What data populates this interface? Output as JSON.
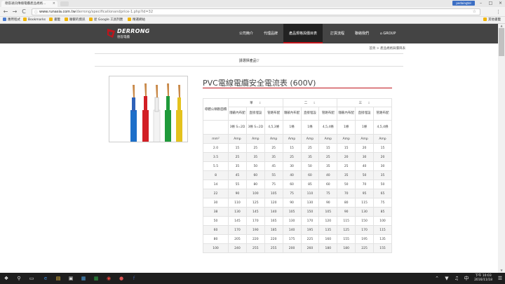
{
  "browser": {
    "tab_title": "德容通訊傳播電纜產品規格…",
    "tab_close": "×",
    "profile_label": "pedaingtel",
    "win_min": "–",
    "win_max": "□",
    "win_close": "×",
    "back": "←",
    "forward": "→",
    "reload": "C",
    "url_domain": "www.runasia.com.tw",
    "url_path": "/derrong/specificationandprice-1.php?id=32",
    "bookmarks": [
      {
        "label": "應用程式",
        "color": "#4a7bd0"
      },
      {
        "label": "Bookmarks",
        "color": "#f0b400"
      },
      {
        "label": "書籤",
        "color": "#f0b400"
      },
      {
        "label": "聯繫的資訊",
        "color": "#f0b400"
      },
      {
        "label": "從 Google 工具列匯",
        "color": "#f0b400"
      },
      {
        "label": "精選網站",
        "color": "#f0b400"
      }
    ],
    "other_bookmarks": "其他書籤"
  },
  "site": {
    "brand_en": "DERRONG",
    "brand_cn": "德容電纜",
    "brand_color": "#c0141b",
    "nav": [
      "公司簡介",
      "代理品牌",
      "產品規格與價目表",
      "訂貨流程",
      "聯絡我們",
      "GROUP"
    ],
    "breadcrumb": "首頁 > 產品規格與價目表",
    "select_product": "請選擇產品▽"
  },
  "product": {
    "title": "PVC電線電纜安全電流表 (600V)"
  },
  "table": {
    "corner": "導體公稱斷面積",
    "groups": [
      "單",
      "二",
      "三"
    ],
    "group_arrow": "⇓",
    "sub_headers": [
      "隱蔽內布配",
      "直接埋設",
      "管路布配",
      "隱蔽內布配",
      "直接埋設",
      "管路布配",
      "隱蔽內布配",
      "直接埋設",
      "管路布配"
    ],
    "conditions": [
      "3條 S=2D",
      "3條 S=2D",
      "4,5,3條",
      "1條",
      "1條",
      "4,5,4條",
      "1條",
      "1條",
      "4,5,4條"
    ],
    "unit_label": "mm²",
    "unit": "Amp",
    "rows": [
      [
        "2.0",
        "15",
        "25",
        "25",
        "15",
        "25",
        "15",
        "15",
        "20",
        "15"
      ],
      [
        "3.5",
        "25",
        "35",
        "35",
        "25",
        "35",
        "25",
        "20",
        "30",
        "20"
      ],
      [
        "5.5",
        "35",
        "50",
        "45",
        "30",
        "50",
        "35",
        "25",
        "40",
        "30"
      ],
      [
        "8",
        "45",
        "60",
        "55",
        "40",
        "60",
        "40",
        "35",
        "50",
        "35"
      ],
      [
        "14",
        "55",
        "80",
        "75",
        "60",
        "85",
        "60",
        "50",
        "70",
        "50"
      ],
      [
        "22",
        "90",
        "100",
        "105",
        "75",
        "110",
        "75",
        "70",
        "95",
        "65"
      ],
      [
        "30",
        "110",
        "125",
        "120",
        "90",
        "130",
        "90",
        "80",
        "115",
        "75"
      ],
      [
        "38",
        "130",
        "145",
        "140",
        "105",
        "150",
        "105",
        "90",
        "130",
        "85"
      ],
      [
        "50",
        "145",
        "170",
        "165",
        "130",
        "170",
        "120",
        "115",
        "150",
        "100"
      ],
      [
        "60",
        "170",
        "190",
        "185",
        "140",
        "195",
        "135",
        "125",
        "170",
        "115"
      ],
      [
        "80",
        "205",
        "220",
        "220",
        "175",
        "225",
        "160",
        "155",
        "195",
        "135"
      ],
      [
        "100",
        "240",
        "255",
        "255",
        "200",
        "260",
        "180",
        "180",
        "225",
        "155"
      ]
    ]
  },
  "taskbar": {
    "time": "下午 10:03",
    "date": "2016/11/18"
  }
}
